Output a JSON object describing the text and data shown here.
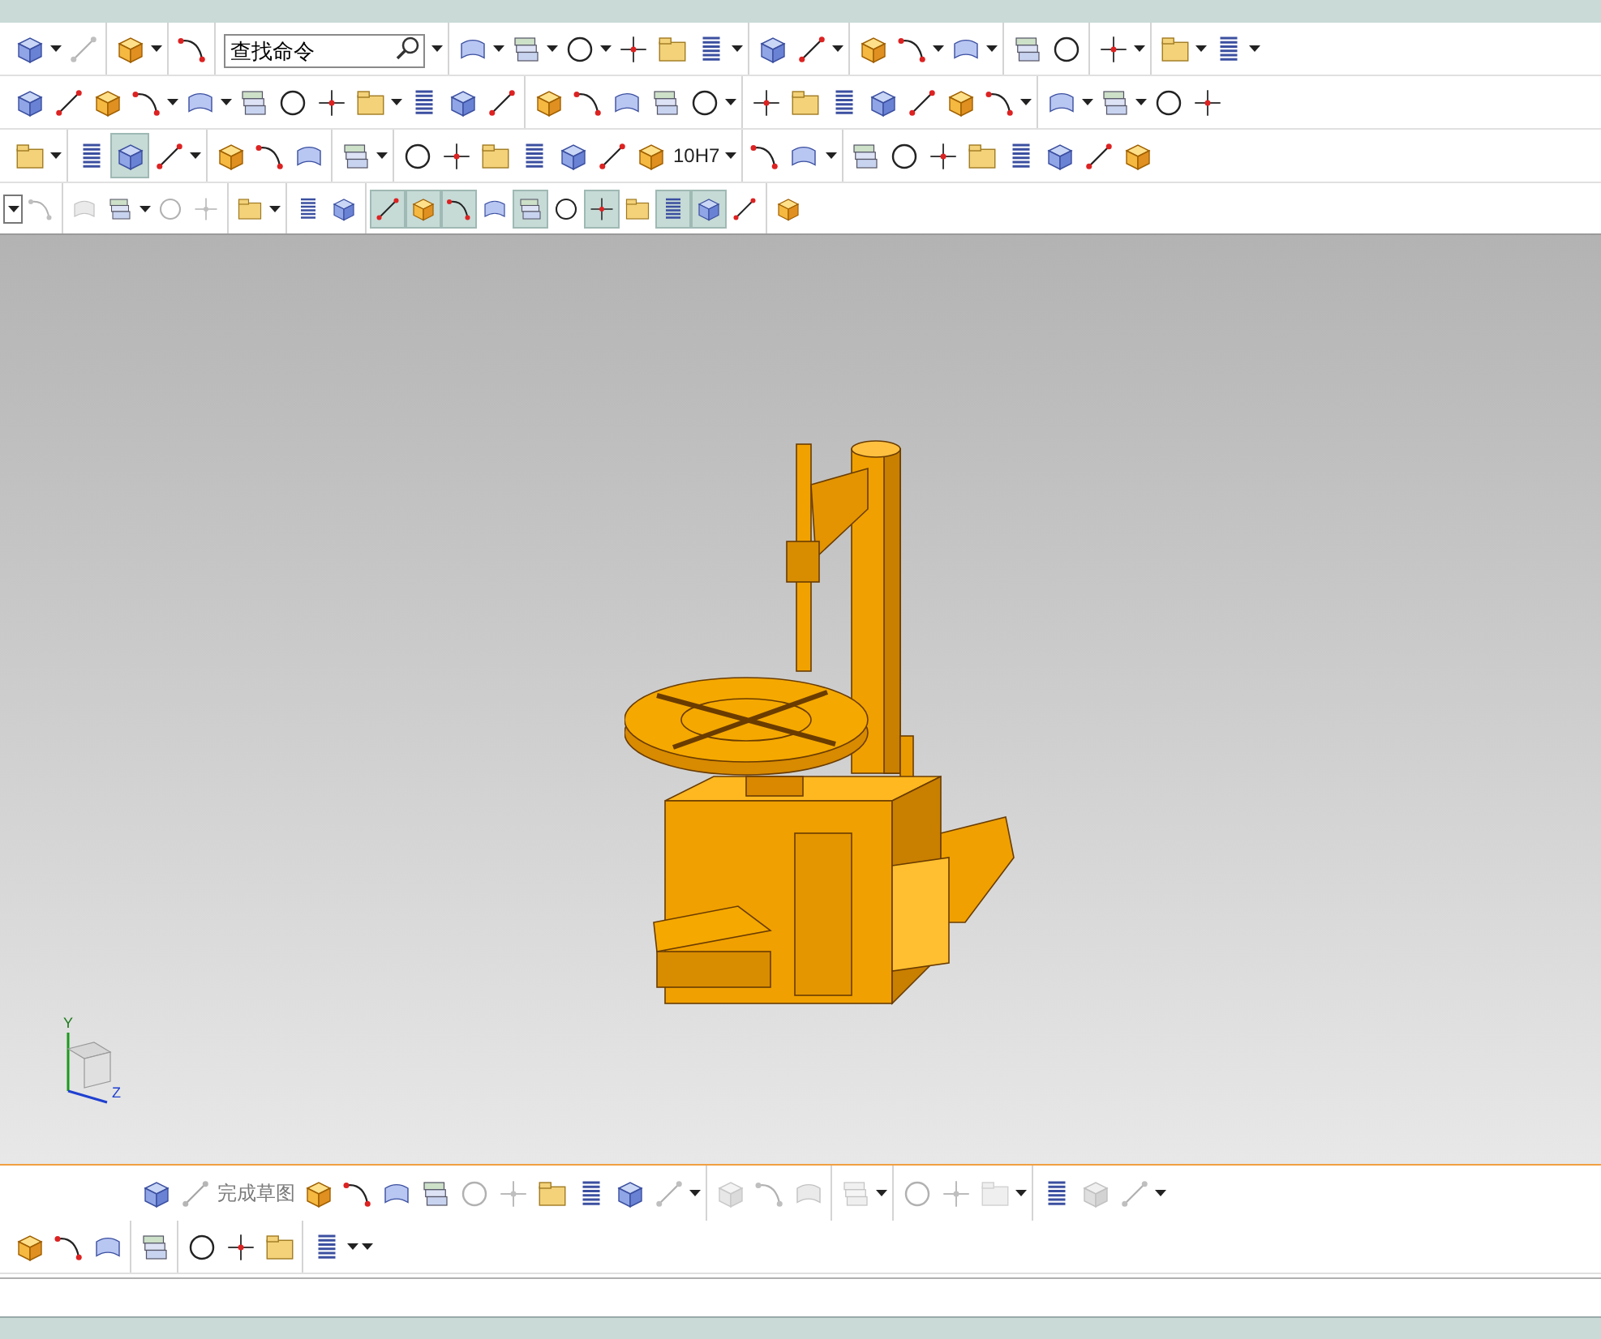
{
  "toolbar_rows": [
    {
      "groups": [
        {
          "items": [
            {
              "kind": "tool",
              "disabled": false,
              "selected": false
            },
            {
              "kind": "caret"
            },
            {
              "kind": "tool",
              "disabled": true,
              "selected": false
            }
          ]
        },
        {
          "items": [
            {
              "kind": "tool",
              "disabled": false,
              "selected": false
            },
            {
              "kind": "caret"
            }
          ]
        },
        {
          "items": [
            {
              "kind": "tool",
              "disabled": false,
              "selected": false
            }
          ]
        },
        {
          "items": [
            {
              "kind": "search",
              "placeholder": "查找命令"
            },
            {
              "kind": "caret"
            }
          ]
        },
        {
          "items": [
            {
              "kind": "tool",
              "disabled": false,
              "selected": false
            },
            {
              "kind": "caret"
            },
            {
              "kind": "tool",
              "disabled": false,
              "selected": false
            },
            {
              "kind": "caret"
            },
            {
              "kind": "tool",
              "disabled": false,
              "selected": false
            },
            {
              "kind": "caret"
            },
            {
              "kind": "tool",
              "disabled": false,
              "selected": false
            },
            {
              "kind": "tool",
              "disabled": false,
              "selected": false
            },
            {
              "kind": "tool",
              "disabled": false,
              "selected": false
            },
            {
              "kind": "caret"
            }
          ]
        },
        {
          "items": [
            {
              "kind": "tool",
              "disabled": false,
              "selected": false
            },
            {
              "kind": "tool",
              "disabled": false,
              "selected": false
            },
            {
              "kind": "caret"
            }
          ]
        },
        {
          "items": [
            {
              "kind": "tool",
              "disabled": false,
              "selected": false
            },
            {
              "kind": "tool",
              "disabled": false,
              "selected": false
            },
            {
              "kind": "caret"
            },
            {
              "kind": "tool",
              "disabled": false,
              "selected": false
            },
            {
              "kind": "caret"
            }
          ]
        },
        {
          "items": [
            {
              "kind": "tool",
              "disabled": false,
              "selected": false
            },
            {
              "kind": "tool",
              "disabled": false,
              "selected": false
            }
          ]
        },
        {
          "items": [
            {
              "kind": "tool",
              "disabled": false,
              "selected": false
            },
            {
              "kind": "caret"
            }
          ]
        },
        {
          "items": [
            {
              "kind": "tool",
              "disabled": false,
              "selected": false
            },
            {
              "kind": "caret"
            },
            {
              "kind": "tool",
              "disabled": false,
              "selected": false
            },
            {
              "kind": "caret"
            }
          ]
        }
      ]
    },
    {
      "groups": [
        {
          "items": [
            {
              "kind": "tool",
              "disabled": false,
              "selected": false
            },
            {
              "kind": "tool",
              "disabled": false,
              "selected": false
            },
            {
              "kind": "tool",
              "disabled": false,
              "selected": false
            },
            {
              "kind": "tool",
              "disabled": false,
              "selected": false
            },
            {
              "kind": "caret"
            },
            {
              "kind": "tool",
              "disabled": false,
              "selected": false
            },
            {
              "kind": "caret"
            },
            {
              "kind": "tool",
              "disabled": false,
              "selected": false
            },
            {
              "kind": "tool",
              "disabled": false,
              "selected": false
            },
            {
              "kind": "tool",
              "disabled": false,
              "selected": false
            },
            {
              "kind": "tool",
              "disabled": false,
              "selected": false
            },
            {
              "kind": "caret"
            },
            {
              "kind": "tool",
              "disabled": false,
              "selected": false
            },
            {
              "kind": "tool",
              "disabled": false,
              "selected": false
            },
            {
              "kind": "tool",
              "disabled": false,
              "selected": false
            }
          ]
        },
        {
          "items": [
            {
              "kind": "tool",
              "disabled": false,
              "selected": false
            },
            {
              "kind": "tool",
              "disabled": false,
              "selected": false
            },
            {
              "kind": "tool",
              "disabled": false,
              "selected": false
            },
            {
              "kind": "tool",
              "disabled": false,
              "selected": false
            },
            {
              "kind": "tool",
              "disabled": false,
              "selected": false
            },
            {
              "kind": "caret"
            }
          ]
        },
        {
          "items": [
            {
              "kind": "tool",
              "disabled": false,
              "selected": false
            },
            {
              "kind": "tool",
              "disabled": false,
              "selected": false
            },
            {
              "kind": "tool",
              "disabled": false,
              "selected": false
            },
            {
              "kind": "tool",
              "disabled": false,
              "selected": false
            },
            {
              "kind": "tool",
              "disabled": false,
              "selected": false
            },
            {
              "kind": "tool",
              "disabled": false,
              "selected": false
            },
            {
              "kind": "tool",
              "disabled": false,
              "selected": false
            },
            {
              "kind": "caret"
            }
          ]
        },
        {
          "items": [
            {
              "kind": "tool",
              "disabled": false,
              "selected": false
            },
            {
              "kind": "caret"
            },
            {
              "kind": "tool",
              "disabled": false,
              "selected": false
            },
            {
              "kind": "caret"
            },
            {
              "kind": "tool",
              "disabled": false,
              "selected": false
            },
            {
              "kind": "tool",
              "disabled": false,
              "selected": false
            }
          ]
        }
      ]
    },
    {
      "groups": [
        {
          "items": [
            {
              "kind": "tool",
              "disabled": false,
              "selected": false
            },
            {
              "kind": "caret"
            }
          ]
        },
        {
          "items": [
            {
              "kind": "tool",
              "disabled": false,
              "selected": false
            },
            {
              "kind": "tool",
              "disabled": false,
              "selected": true
            },
            {
              "kind": "tool",
              "disabled": false,
              "selected": false
            },
            {
              "kind": "caret"
            }
          ]
        },
        {
          "items": [
            {
              "kind": "tool",
              "disabled": false,
              "selected": false
            },
            {
              "kind": "tool",
              "disabled": false,
              "selected": false
            },
            {
              "kind": "tool",
              "disabled": false,
              "selected": false
            }
          ]
        },
        {
          "items": [
            {
              "kind": "tool",
              "disabled": false,
              "selected": false
            },
            {
              "kind": "caret"
            }
          ]
        },
        {
          "items": [
            {
              "kind": "tool",
              "disabled": false,
              "selected": false
            },
            {
              "kind": "tool",
              "disabled": false,
              "selected": false
            },
            {
              "kind": "tool",
              "disabled": false,
              "selected": false
            },
            {
              "kind": "tool",
              "disabled": false,
              "selected": false
            },
            {
              "kind": "tool",
              "disabled": false,
              "selected": false
            },
            {
              "kind": "tool",
              "disabled": false,
              "selected": false
            },
            {
              "kind": "labeled",
              "label": "10H7",
              "disabled": false
            },
            {
              "kind": "caret"
            }
          ]
        },
        {
          "items": [
            {
              "kind": "tool",
              "disabled": false,
              "selected": false
            },
            {
              "kind": "tool",
              "disabled": false,
              "selected": false
            },
            {
              "kind": "caret"
            }
          ]
        },
        {
          "items": [
            {
              "kind": "tool",
              "disabled": false,
              "selected": false
            },
            {
              "kind": "tool",
              "disabled": false,
              "selected": false
            },
            {
              "kind": "tool",
              "disabled": false,
              "selected": false
            },
            {
              "kind": "tool",
              "disabled": false,
              "selected": false
            },
            {
              "kind": "tool",
              "disabled": false,
              "selected": false
            },
            {
              "kind": "tool",
              "disabled": false,
              "selected": false
            },
            {
              "kind": "tool",
              "disabled": false,
              "selected": false
            },
            {
              "kind": "tool",
              "disabled": false,
              "selected": false
            }
          ]
        }
      ]
    },
    {
      "groups": [
        {
          "items": [
            {
              "kind": "select"
            },
            {
              "kind": "tool",
              "disabled": true,
              "selected": false
            }
          ]
        },
        {
          "items": [
            {
              "kind": "tool",
              "disabled": true,
              "selected": false
            },
            {
              "kind": "tool",
              "disabled": false,
              "selected": false
            },
            {
              "kind": "caret"
            },
            {
              "kind": "tool",
              "disabled": true,
              "selected": false
            },
            {
              "kind": "tool",
              "disabled": true,
              "selected": false
            }
          ]
        },
        {
          "items": [
            {
              "kind": "tool",
              "disabled": false,
              "selected": false
            },
            {
              "kind": "caret"
            }
          ]
        },
        {
          "items": [
            {
              "kind": "tool",
              "disabled": false,
              "selected": false
            },
            {
              "kind": "tool",
              "disabled": false,
              "selected": false
            }
          ]
        },
        {
          "items": [
            {
              "kind": "tool",
              "disabled": false,
              "selected": true
            },
            {
              "kind": "tool",
              "disabled": false,
              "selected": true
            },
            {
              "kind": "tool",
              "disabled": false,
              "selected": true
            },
            {
              "kind": "tool",
              "disabled": false,
              "selected": false
            },
            {
              "kind": "tool",
              "disabled": false,
              "selected": true
            },
            {
              "kind": "tool",
              "disabled": false,
              "selected": false
            },
            {
              "kind": "tool",
              "disabled": false,
              "selected": true
            },
            {
              "kind": "tool",
              "disabled": false,
              "selected": false
            },
            {
              "kind": "tool",
              "disabled": false,
              "selected": true
            },
            {
              "kind": "tool",
              "disabled": false,
              "selected": true
            },
            {
              "kind": "tool",
              "disabled": false,
              "selected": false
            }
          ]
        },
        {
          "items": [
            {
              "kind": "tool",
              "disabled": false,
              "selected": false
            }
          ]
        }
      ]
    }
  ],
  "triad": {
    "y_label": "Y",
    "z_label": "Z"
  },
  "bottom_rows": [
    {
      "groups": [
        {
          "items": [
            {
              "kind": "tool",
              "disabled": false,
              "selected": false
            },
            {
              "kind": "labeled",
              "label": "完成草图",
              "disabled": true
            },
            {
              "kind": "tool",
              "disabled": false,
              "selected": false
            },
            {
              "kind": "tool",
              "disabled": false,
              "selected": false
            },
            {
              "kind": "tool",
              "disabled": false,
              "selected": false
            },
            {
              "kind": "tool",
              "disabled": false,
              "selected": false
            },
            {
              "kind": "tool",
              "disabled": true,
              "selected": false
            },
            {
              "kind": "tool",
              "disabled": true,
              "selected": false
            },
            {
              "kind": "tool",
              "disabled": false,
              "selected": false
            },
            {
              "kind": "tool",
              "disabled": false,
              "selected": false
            },
            {
              "kind": "tool",
              "disabled": false,
              "selected": false
            },
            {
              "kind": "tool",
              "disabled": true,
              "selected": false
            },
            {
              "kind": "caret"
            }
          ]
        },
        {
          "items": [
            {
              "kind": "tool",
              "disabled": true,
              "selected": false
            },
            {
              "kind": "tool",
              "disabled": true,
              "selected": false
            },
            {
              "kind": "tool",
              "disabled": true,
              "selected": false
            }
          ]
        },
        {
          "items": [
            {
              "kind": "tool",
              "disabled": true,
              "selected": false
            },
            {
              "kind": "caret"
            }
          ]
        },
        {
          "items": [
            {
              "kind": "tool",
              "disabled": true,
              "selected": false
            },
            {
              "kind": "tool",
              "disabled": true,
              "selected": false
            },
            {
              "kind": "tool",
              "disabled": true,
              "selected": false
            },
            {
              "kind": "caret"
            }
          ]
        },
        {
          "items": [
            {
              "kind": "tool",
              "disabled": false,
              "selected": false
            },
            {
              "kind": "tool",
              "disabled": true,
              "selected": false
            },
            {
              "kind": "tool",
              "disabled": true,
              "selected": false
            },
            {
              "kind": "caret"
            }
          ]
        }
      ]
    },
    {
      "groups": [
        {
          "items": [
            {
              "kind": "tool",
              "disabled": false,
              "selected": false
            },
            {
              "kind": "tool",
              "disabled": false,
              "selected": false
            },
            {
              "kind": "tool",
              "disabled": false,
              "selected": false
            }
          ]
        },
        {
          "items": [
            {
              "kind": "tool",
              "disabled": false,
              "selected": false
            }
          ]
        },
        {
          "items": [
            {
              "kind": "tool",
              "disabled": false,
              "selected": false
            },
            {
              "kind": "tool",
              "disabled": false,
              "selected": false
            },
            {
              "kind": "tool",
              "disabled": false,
              "selected": false
            }
          ]
        },
        {
          "items": [
            {
              "kind": "tool",
              "disabled": false,
              "selected": false
            },
            {
              "kind": "caret"
            },
            {
              "kind": "caret"
            }
          ]
        }
      ]
    }
  ]
}
